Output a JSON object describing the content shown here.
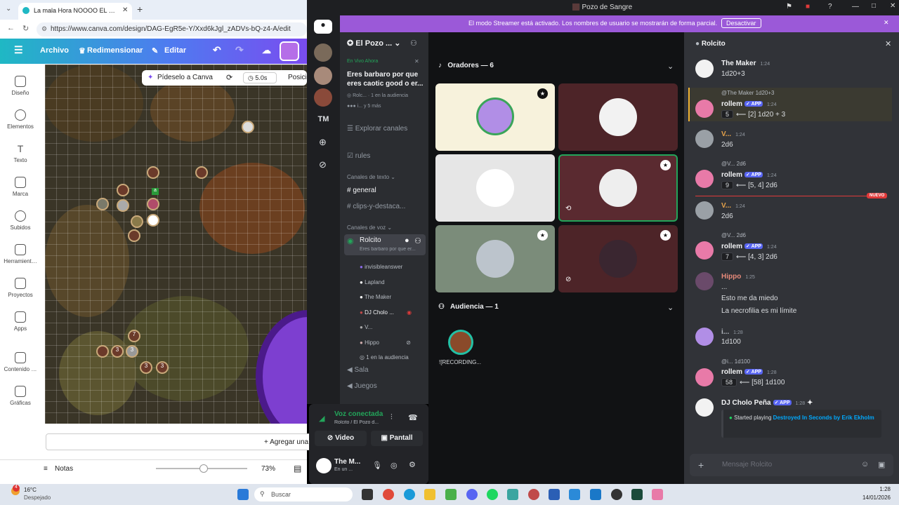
{
  "browser": {
    "tab_title": "La mala Hora NOOOO EL CROW M",
    "url": "https://www.canva.com/design/DAG-EgR5e-Y/Xxd6kJgl_zADVs-bQ-z4-A/edit",
    "new_tab_symbol": "+"
  },
  "canva": {
    "menu": [
      "Archivo",
      "Redimensionar",
      "Editar"
    ],
    "ask_label": "Pídeselo a Canva",
    "duration": "5.0s",
    "position_label": "Posici",
    "sidebar": [
      "Diseño",
      "Elementos",
      "Texto",
      "Marca",
      "Subidos",
      "Herramient…",
      "Proyectos",
      "Apps",
      "Contenido …",
      "Gráficas"
    ],
    "add_page": "+ Agregar una",
    "notes": "Notas",
    "zoom": "73%",
    "tokens": [
      "a",
      "7",
      "3",
      "3",
      "3",
      "3"
    ]
  },
  "discord": {
    "window_title": "El Pozo de Sangre",
    "streamer_banner": "El modo Streamer está activado. Los nombres de usuario se mostrarán de forma parcial.",
    "disable_button": "Desactivar",
    "server_name": "El Pozo ...",
    "live": {
      "tag": "En Vivo Ahora",
      "title": "Eres barbaro por que eres caotic good o er...",
      "host": "Rolc...",
      "audience": "1 en la audiencia",
      "more": "i... y 5 más"
    },
    "explore": "Explorar canales",
    "rules": "rules",
    "text_category": "Canales de texto",
    "text_channels": [
      "general",
      "clips-y-destaca..."
    ],
    "voice_category": "Canales de voz",
    "voice_channel": "Rolcito",
    "voice_topic": "Eres barbaro por que er...",
    "voice_users": [
      "invisibleanswer",
      "Lapland",
      "The Maker",
      "DJ Cholo ...",
      "V...",
      "Hippo"
    ],
    "audience_count": "1 en la audiencia",
    "other_voice": [
      "Sala",
      "Juegos"
    ],
    "guild_initials": "TM",
    "voice_connected": "Voz conectada",
    "voice_sub": "Rolcito / El Pozo d...",
    "video_btn": "Video",
    "screen_btn": "Pantall",
    "user_name": "The M...",
    "user_status": "En un ...",
    "speakers_header": "Oradores — 6",
    "audience_header": "Audiencia — 1",
    "audience_user": "![RECORDING...",
    "tile_badges": [
      "★",
      "★",
      "★"
    ],
    "chat_title": "Rolcito",
    "new_tag": "NUEVO",
    "app_tag": "✓ APP",
    "input_placeholder": "Mensaje Rolcito",
    "messages": [
      {
        "user": "The Maker",
        "time": "1:24",
        "text": "1d20+3"
      },
      {
        "reply": "@The Maker 1d20+3",
        "user": "rollem",
        "time": "1:24",
        "dice": "5",
        "text": "⟵ [2] 1d20 + 3"
      },
      {
        "user": "V...",
        "time": "1:24",
        "text": "2d6"
      },
      {
        "reply": "@V... 2d6",
        "user": "rollem",
        "time": "1:24",
        "dice": "9",
        "text": "⟵ [5, 4] 2d6"
      },
      {
        "user": "V...",
        "time": "1:24",
        "text": "2d6"
      },
      {
        "reply": "@V... 2d6",
        "user": "rollem",
        "time": "1:24",
        "dice": "7",
        "text": "⟵ [4, 3] 2d6"
      },
      {
        "user": "Hippo",
        "time": "1:25",
        "text": "...",
        "text2": "Esto me da miedo",
        "text3": "La necrofilia es mi límite"
      },
      {
        "user": "i...",
        "time": "1:28",
        "text": "1d100"
      },
      {
        "reply": "@i... 1d100",
        "user": "rollem",
        "time": "1:28",
        "dice": "58",
        "text": "⟵ [58] 1d100"
      },
      {
        "user": "DJ Cholo Peña",
        "time": "1:28",
        "embed_prefix": "Started playing ",
        "embed_link": "Destroyed In Seconds by Erik Ekholm"
      }
    ]
  },
  "taskbar": {
    "weather_temp": "16°C",
    "weather_desc": "Despejado",
    "search": "Buscar",
    "time": "1:28",
    "date": "14/01/2026",
    "badge": "4"
  }
}
